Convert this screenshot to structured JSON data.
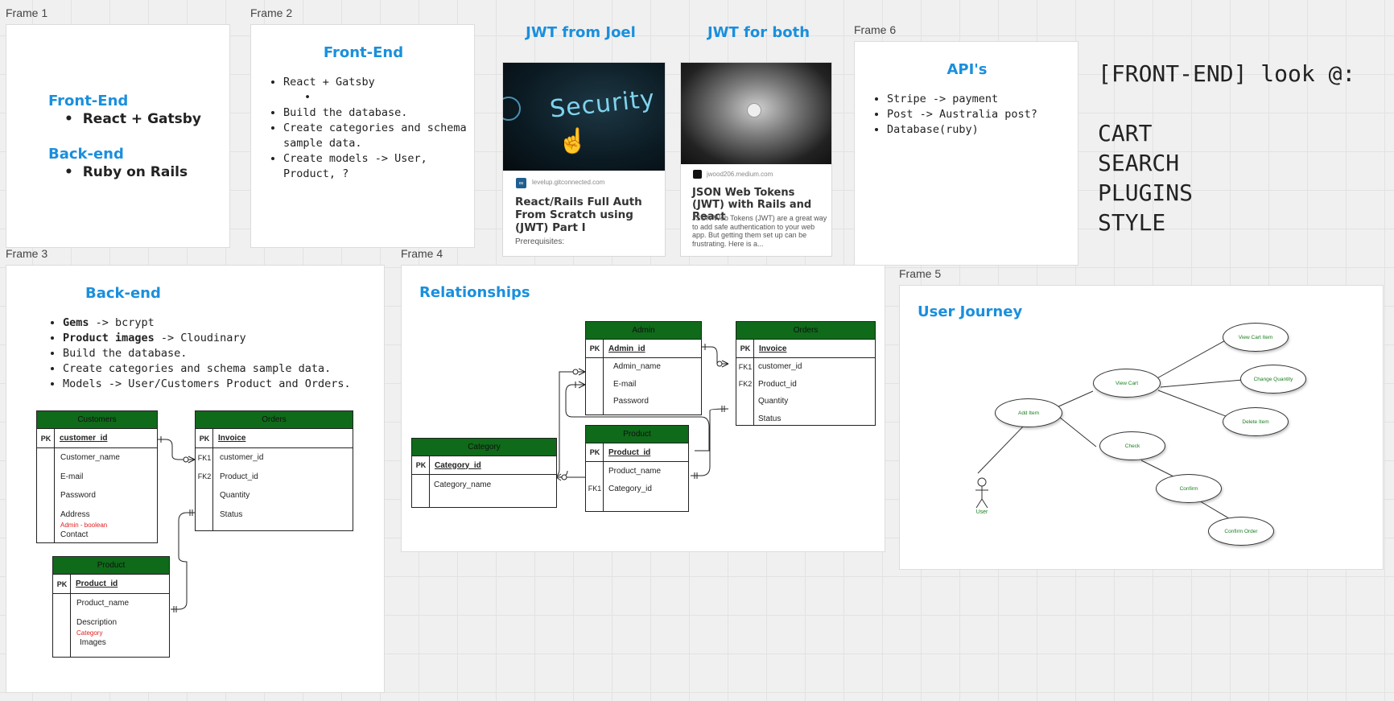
{
  "frames": {
    "f1": "Frame 1",
    "f2": "Frame 2",
    "f3": "Frame 3",
    "f4": "Frame 4",
    "f5": "Frame 5",
    "f6": "Frame 6"
  },
  "frame1": {
    "front_title": "Front-End",
    "front_item": "React + Gatsby",
    "back_title": "Back-end",
    "back_item": "Ruby on Rails"
  },
  "frame2": {
    "title": "Front-End",
    "items": [
      "React + Gatsby",
      "Build the database.",
      "Create categories and schema sample data.",
      "Create models -> User, Product, ?"
    ]
  },
  "jwt_joel": {
    "heading": "JWT from Joel",
    "domain": "levelup.gitconnected.com",
    "title": "React/Rails Full Auth From Scratch using (JWT) Part I",
    "desc": "Prerequisites:",
    "image_text": "Security"
  },
  "jwt_both": {
    "heading": "JWT for both",
    "domain": "jwood206.medium.com",
    "title": "JSON Web Tokens (JWT) with Rails and React",
    "desc": "JSON Web Tokens (JWT) are a great way to add safe authentication to your web app. But getting them set up can be frustrating. Here is a..."
  },
  "frame6": {
    "title": "API's",
    "items": [
      "Stripe -> payment",
      "Post -> Australia post?",
      "Database(ruby)"
    ]
  },
  "notes": {
    "heading": "[FRONT-END] look @:",
    "items": [
      "CART",
      "SEARCH",
      "PLUGINS",
      "STYLE"
    ]
  },
  "frame3": {
    "title": "Back-end",
    "items": [
      {
        "bold": "Gems",
        "rest": " -> bcrypt"
      },
      {
        "bold": "Product images",
        "rest": " -> Cloudinary"
      },
      {
        "bold": "",
        "rest": "Build the database."
      },
      {
        "bold": "",
        "rest": "Create categories and schema sample data."
      },
      {
        "bold": "",
        "rest": "Models -> User/Customers Product and Orders."
      }
    ],
    "customers": {
      "name": "Customers",
      "pk": "PK",
      "pk_field": "customer_id",
      "fields": [
        "Customer_name",
        "E-mail",
        "Password",
        "Address"
      ],
      "note": "Admin - boolean",
      "last": "Contact"
    },
    "orders": {
      "name": "Orders",
      "pk": "PK",
      "pk_field": "Invoice",
      "k1": "FK1",
      "f1": "customer_id",
      "k2": "FK2",
      "f2": "Product_id",
      "fields": [
        "Quantity",
        "Status"
      ]
    },
    "product": {
      "name": "Product",
      "pk": "PK",
      "pk_field": "Product_id",
      "fields": [
        "Product_name",
        "Description"
      ],
      "note": "Category",
      "last": "Images"
    }
  },
  "frame4": {
    "title": "Relationships",
    "admin": {
      "name": "Admin",
      "pk": "PK",
      "pk_field": "Admin_id",
      "fields": [
        "Admin_name",
        "E-mail",
        "Password"
      ]
    },
    "orders": {
      "name": "Orders",
      "pk": "PK",
      "pk_field": "Invoice",
      "k1": "FK1",
      "f1": "customer_id",
      "k2": "FK2",
      "f2": "Product_id",
      "fields": [
        "Quantity",
        "Status"
      ]
    },
    "category": {
      "name": "Category",
      "pk": "PK",
      "pk_field": "Category_id",
      "field": "Category_name"
    },
    "product": {
      "name": "Product",
      "pk": "PK",
      "pk_field": "Product_id",
      "field": "Product_name",
      "k1": "FK1",
      "f1": "Category_id"
    }
  },
  "frame5": {
    "title": "User Journey",
    "actor": "User",
    "nodes": {
      "add_item": "Add Item",
      "view_cart": "View Cart",
      "view_cart_item": "View Cart Item",
      "change_quantity": "Change Quantity",
      "delete_item": "Delete Item",
      "check": "Check",
      "confirm": "Confirm",
      "confirm_order": "Confirm Order"
    }
  },
  "colors": {
    "title_blue": "#1a8fdd",
    "erd_header_green": "#0f6a1a",
    "note_red": "#e02020",
    "usecase_text_green": "#1a7f20"
  }
}
